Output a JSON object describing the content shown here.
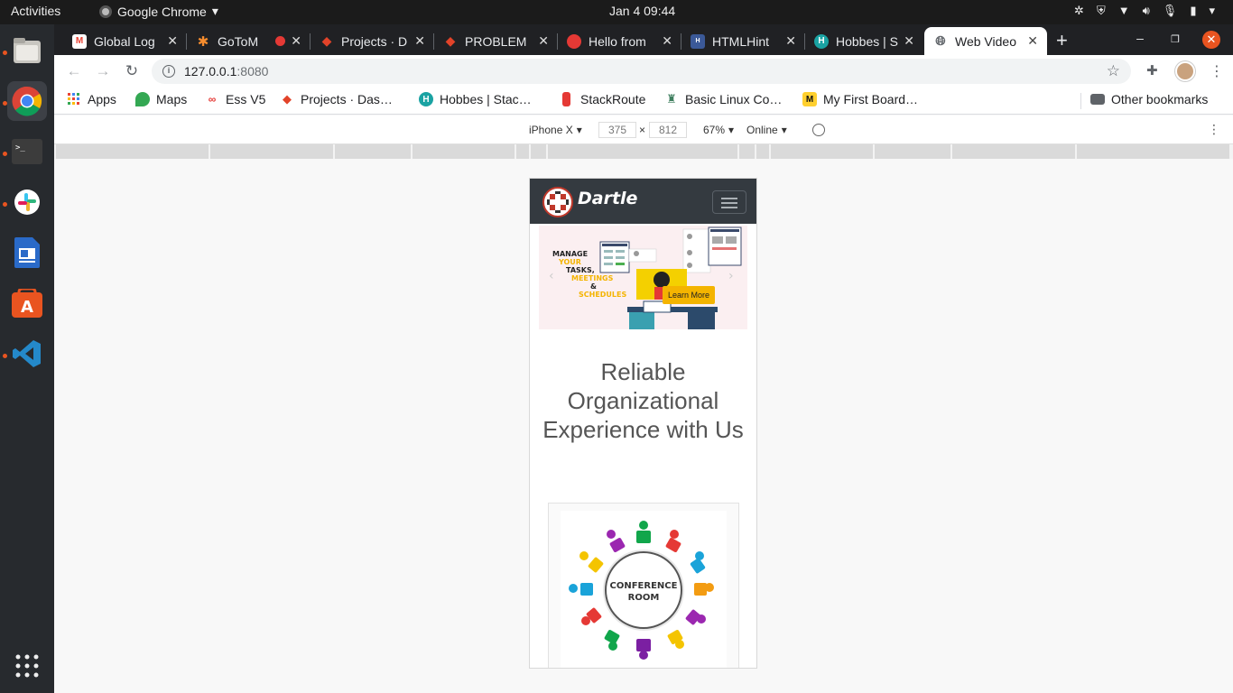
{
  "topbar": {
    "activities": "Activities",
    "app_name": "Google Chrome",
    "clock": "Jan 4  09:44"
  },
  "dock": {
    "apps": [
      "files-icon",
      "chrome-icon",
      "terminal-icon",
      "slack-icon",
      "text-editor-icon",
      "software-center-icon",
      "vscode-icon",
      "app-grid-icon"
    ]
  },
  "tabs": [
    {
      "title": "Global Log",
      "favicon": "gmail-icon",
      "color": "#ea4335"
    },
    {
      "title": "GoToM",
      "favicon": "gotomeeting-icon",
      "color": "#f68d2e"
    },
    {
      "title": "Projects · D",
      "favicon": "gitlab-icon",
      "color": "#e24329"
    },
    {
      "title": "PROBLEM",
      "favicon": "gitlab-icon",
      "color": "#e24329"
    },
    {
      "title": "Hello from",
      "favicon": "hello-icon",
      "color": "#e53935"
    },
    {
      "title": "HTMLHint",
      "favicon": "htmlhint-icon",
      "color": "#3b5998"
    },
    {
      "title": "Hobbes | S",
      "favicon": "hobbes-icon",
      "color": "#1aa3a3"
    },
    {
      "title": "Web Video",
      "favicon": "globe-icon",
      "color": "#5f6368"
    }
  ],
  "toolbar": {
    "url_host": "127.0.0.1",
    "url_port": ":8080"
  },
  "bookmarks": [
    {
      "label": "Apps",
      "icon": "apps-grid-icon",
      "color": "#4285f4"
    },
    {
      "label": "Maps",
      "icon": "maps-icon",
      "color": "#34a853"
    },
    {
      "label": "Ess V5",
      "icon": "ess-icon",
      "color": "#e53935"
    },
    {
      "label": "Projects · Das…",
      "icon": "gitlab-icon",
      "color": "#e24329"
    },
    {
      "label": "Hobbes | Stac…",
      "icon": "hobbes-icon",
      "color": "#1aa3a3"
    },
    {
      "label": "StackRoute",
      "icon": "stackroute-icon",
      "color": "#e53935"
    },
    {
      "label": "Basic Linux Co…",
      "icon": "robot-icon",
      "color": "#3f7f5f"
    },
    {
      "label": "My First Board…",
      "icon": "miro-icon",
      "color": "#ffd02f"
    },
    {
      "label": "Other bookmarks",
      "icon": "folder-icon",
      "color": "#5f6368"
    }
  ],
  "devtools": {
    "device": "iPhone X",
    "width": "375",
    "times": "×",
    "height": "812",
    "zoom": "67%",
    "network": "Online"
  },
  "site": {
    "brand": "Dartle",
    "banner": {
      "line1": "MANAGE",
      "line2": "YOUR",
      "line3": "TASKS,",
      "line4": "MEETINGS",
      "line5": "&",
      "line6": "SCHEDULES",
      "cta": "Learn More"
    },
    "heading": "Reliable Organizational Experience with Us",
    "card": {
      "line1": "CONFERENCE",
      "line2": "ROOM"
    }
  }
}
